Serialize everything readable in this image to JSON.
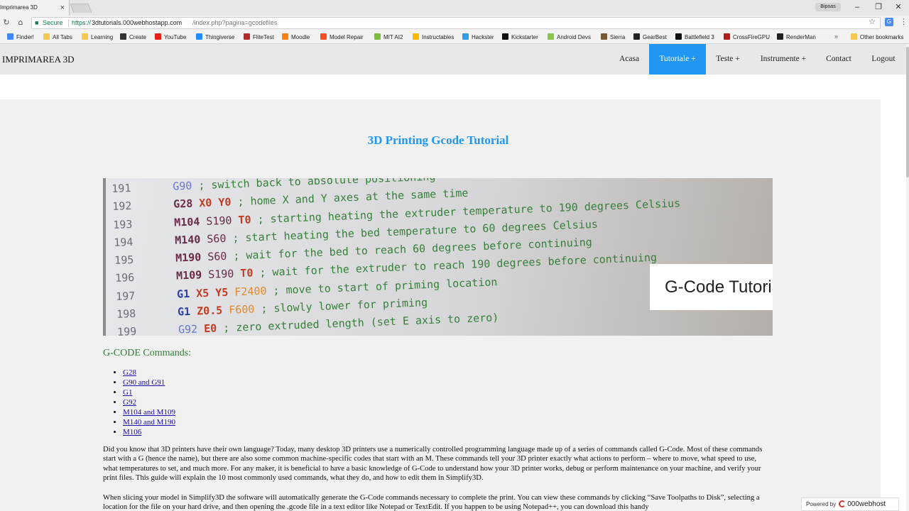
{
  "browser": {
    "tab_title": "Imprimarea 3D",
    "tab_close": "×",
    "user_label": "Bipoas",
    "window_controls": {
      "minimize": "–",
      "restore": "❐",
      "close": "✕"
    },
    "nav": {
      "back": "←",
      "forward": "→",
      "reload": "↻",
      "home": "⌂"
    },
    "secure_label": "Secure",
    "url_scheme": "https://",
    "url_host": "3dtutorials.000webhostapp.com",
    "url_path": "/index.php?pagina=gcodefiles",
    "star": "☆",
    "ext": "G",
    "menu": "⋮"
  },
  "bookmarks": [
    {
      "label": "Finder!",
      "icon": "google-icon",
      "color": "#4285f4"
    },
    {
      "label": "All Tabs",
      "icon": "folder-icon",
      "color": "#f5c84c"
    },
    {
      "label": "Learning",
      "icon": "folder-icon",
      "color": "#f5c84c"
    },
    {
      "label": "Create",
      "icon": "cc-icon",
      "color": "#333333"
    },
    {
      "label": "YouTube",
      "icon": "youtube-icon",
      "color": "#e62117"
    },
    {
      "label": "Thingiverse",
      "icon": "thingiverse-icon",
      "color": "#248bfb"
    },
    {
      "label": "FliteTest",
      "icon": "flitetest-icon",
      "color": "#b52b2b"
    },
    {
      "label": "Moodle",
      "icon": "moodle-icon",
      "color": "#f98012"
    },
    {
      "label": "Model Repair",
      "icon": "microsoft-icon",
      "color": "#f25022"
    },
    {
      "label": "MIT AI2",
      "icon": "ai2-icon",
      "color": "#7bbf3a"
    },
    {
      "label": "Instructables",
      "icon": "instructables-icon",
      "color": "#f8b600"
    },
    {
      "label": "Hackster",
      "icon": "hackster-icon",
      "color": "#2e9fe6"
    },
    {
      "label": "Kickstarter",
      "icon": "kickstarter-icon",
      "color": "#111111"
    },
    {
      "label": "Android Devs",
      "icon": "android-icon",
      "color": "#8bc34a"
    },
    {
      "label": "Sierra",
      "icon": "sierra-icon",
      "color": "#7a5a3a"
    },
    {
      "label": "GearBest",
      "icon": "gearbest-icon",
      "color": "#222222"
    },
    {
      "label": "Battlefield 3",
      "icon": "battlefield-icon",
      "color": "#111111"
    },
    {
      "label": "CrossFireGPU",
      "icon": "crossfire-icon",
      "color": "#b71c1c"
    },
    {
      "label": "RenderMan",
      "icon": "renderman-icon",
      "color": "#222222"
    }
  ],
  "bookmarks_more": "»",
  "bookmarks_other": "Other bookmarks",
  "site": {
    "brand": "IMPRIMAREA 3D",
    "nav": [
      "Acasa",
      "Tutoriale +",
      "Teste +",
      "Instrumente +",
      "Contact",
      "Logout"
    ],
    "active_nav": "Tutoriale +",
    "accent_color": "#2196f3"
  },
  "page": {
    "title": "3D Printing Gcode Tutorial",
    "hero_label": "G-Code Tutorial",
    "hero_code": [
      {
        "n": "191",
        "cmd": "G90",
        "params": [],
        "comment": " ; switch back to absolute positioning"
      },
      {
        "n": "192",
        "cmd": "G28",
        "params": [
          "X0",
          "Y0"
        ],
        "comment": " ; home X and Y axes at the same time"
      },
      {
        "n": "193",
        "cmd": "M104",
        "params": [
          "S190",
          "T0"
        ],
        "comment": " ; starting heating the extruder temperature to 190 degrees Celsius"
      },
      {
        "n": "194",
        "cmd": "M140",
        "params": [
          "S60"
        ],
        "comment": " ; start heating the bed temperature to 60 degrees Celsius"
      },
      {
        "n": "195",
        "cmd": "M190",
        "params": [
          "S60"
        ],
        "comment": " ; wait for the bed to reach 60 degrees before continuing"
      },
      {
        "n": "196",
        "cmd": "M109",
        "params": [
          "S190",
          "T0"
        ],
        "comment": " ; wait for the extruder to reach 190 degrees before continuing"
      },
      {
        "n": "197",
        "cmd": "G1",
        "params": [
          "X5",
          "Y5",
          "F2400"
        ],
        "comment": " ; move to start of priming location"
      },
      {
        "n": "198",
        "cmd": "G1",
        "params": [
          "Z0.5",
          "F600"
        ],
        "comment": " ; slowly lower for priming"
      },
      {
        "n": "199",
        "cmd": "G92",
        "params": [
          "E0"
        ],
        "comment": " ; zero extruded length (set E axis to zero)"
      }
    ],
    "commands_heading": "G-CODE Commands:",
    "commands": [
      "G28",
      "G90 and G91",
      "G1",
      "G92",
      "M104 and M109",
      "M140 and M190",
      "M106"
    ],
    "para1": "Did you know that 3D printers have their own language? Today, many desktop 3D printers use a numerically controlled programming language made up of a series of commands called G-Code. Most of these commands start with a G (hence the name), but there are also some common machine-specific codes that start with an M. These commands tell your 3D printer exactly what actions to perform – where to move, what speed to use, what temperatures to set, and much more. For any maker, it is beneficial to have a basic knowledge of G-Code to understand how your 3D printer works, debug or perform maintenance on your machine, and verify your print files. This guide will explain the 10 most commonly used commands, what they do, and how to edit them in Simplify3D.",
    "para2": "When slicing your model in Simplify3D the software will automatically generate the G-Code commands necessary to complete the print. You can view these commands by clicking “Save Toolpaths to Disk”, selecting a location for the file on your hard drive, and then opening the .gcode file in a text editor like Notepad or TextEdit. If you happen to be using Notepad++, you can download this handy"
  },
  "footer": {
    "powered_by": "Powered by",
    "host": "000webhost"
  }
}
